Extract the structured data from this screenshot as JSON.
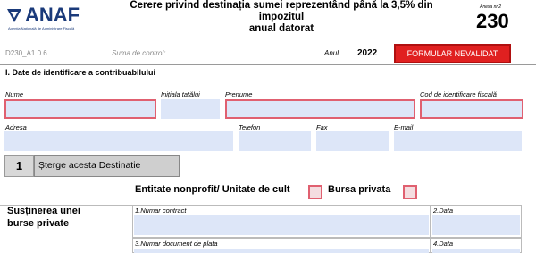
{
  "header": {
    "logo_text": "ANAF",
    "logo_sub": "Agenția Națională de Administrare Fiscală",
    "title_line1": "Cerere privind destinația sumei reprezentând până la 3,5%  din impozitul",
    "title_line2": "anual datorat",
    "anexa": "Anexa nr.2",
    "form_number": "230"
  },
  "meta": {
    "code": "D230_A1.0.6",
    "control_label": "Suma de  control:",
    "anul_label": "Anul",
    "anul_value": "2022",
    "status_button": "FORMULAR NEVALIDAT"
  },
  "section1": {
    "title": "I. Date de identificare a contribuabilului",
    "labels": {
      "nume": "Nume",
      "initiala": "Inițiala tatălui",
      "prenume": "Prenume",
      "cod": "Cod de identificare fiscală",
      "adresa": "Adresa",
      "telefon": "Telefon",
      "fax": "Fax",
      "email": "E-mail"
    }
  },
  "destinatie": {
    "number": "1",
    "delete_button": "Șterge acesta Destinatie",
    "entitate_label": "Entitate nonprofit/ Unitate de cult",
    "bursa_label": "Bursa privata"
  },
  "bursa": {
    "title_line1": "Susținerea unei",
    "title_line2": "burse private",
    "contract_label": "1.Numar contract",
    "data1_label": "2.Data",
    "plata_label": "3.Numar  document de plata",
    "data2_label": "4.Data"
  },
  "colors": {
    "brand": "#1a3a7a",
    "field_bg": "#dde6f8",
    "error_border": "#e06070",
    "status_red": "#e02020"
  }
}
